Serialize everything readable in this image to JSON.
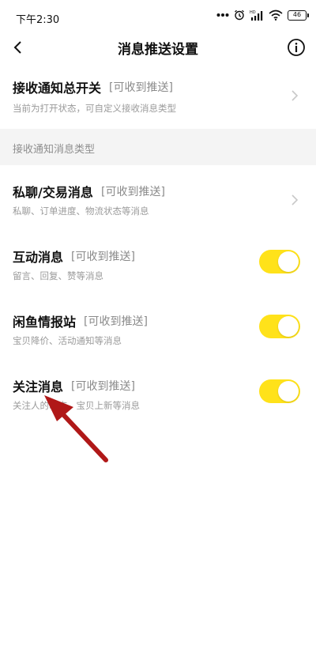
{
  "status_bar": {
    "time": "下午2:30",
    "battery": "46",
    "icons": [
      "dots-icon",
      "alarm-icon",
      "hd-signal-icon",
      "wifi-icon",
      "battery-icon"
    ]
  },
  "nav": {
    "title": "消息推送设置",
    "back_icon": "chevron-left-icon",
    "info_icon": "info-icon"
  },
  "master_switch": {
    "title": "接收通知总开关",
    "tag": "[可收到推送]",
    "subtitle": "当前为打开状态，可自定义接收消息类型"
  },
  "section_header": "接收通知消息类型",
  "items": [
    {
      "title": "私聊/交易消息",
      "tag": "[可收到推送]",
      "subtitle": "私聊、订单进度、物流状态等消息",
      "control": "chevron"
    },
    {
      "title": "互动消息",
      "tag": "[可收到推送]",
      "subtitle": "留言、回复、赞等消息",
      "control": "toggle",
      "enabled": true
    },
    {
      "title": "闲鱼情报站",
      "tag": "[可收到推送]",
      "subtitle": "宝贝降价、活动通知等消息",
      "control": "toggle",
      "enabled": true
    },
    {
      "title": "关注消息",
      "tag": "[可收到推送]",
      "subtitle": "关注人的动态、宝贝上新等消息",
      "control": "toggle",
      "enabled": true
    }
  ],
  "colors": {
    "toggle_on": "#ffe21a",
    "annotation_arrow": "#b01818",
    "section_bg": "#f4f4f4"
  }
}
